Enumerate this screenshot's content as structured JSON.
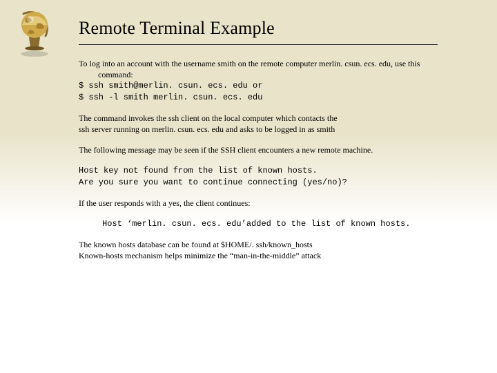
{
  "title": "Remote Terminal Example",
  "intro": {
    "line1": "To log into an account with the username smith on the remote computer merlin. csun. ecs. edu, use this",
    "line2": "command:",
    "cmd1": "$ ssh smith@merlin. csun. ecs. edu or",
    "cmd2": "$ ssh -l smith merlin. csun. ecs. edu"
  },
  "para2": {
    "line1": "The command invokes the ssh client on the local computer which contacts the",
    "line2": "ssh server running on merlin. csun. ecs. edu and asks to be logged in as smith"
  },
  "para3": "The following message may be seen if the SSH client encounters a new remote machine.",
  "msg1": {
    "line1": "Host key not found from the list of known hosts.",
    "line2": "Are you sure you want to continue connecting (yes/no)?"
  },
  "para4": "If the user responds with a yes, the client continues:",
  "msg2": "Host ‘merlin. csun. ecs. edu’added to the list of known hosts.",
  "para5": {
    "line1": "The known hosts database can be found at $HOME/. ssh/known_hosts",
    "line2": "Known-hosts mechanism helps minimize the “man-in-the-middle” attack"
  }
}
